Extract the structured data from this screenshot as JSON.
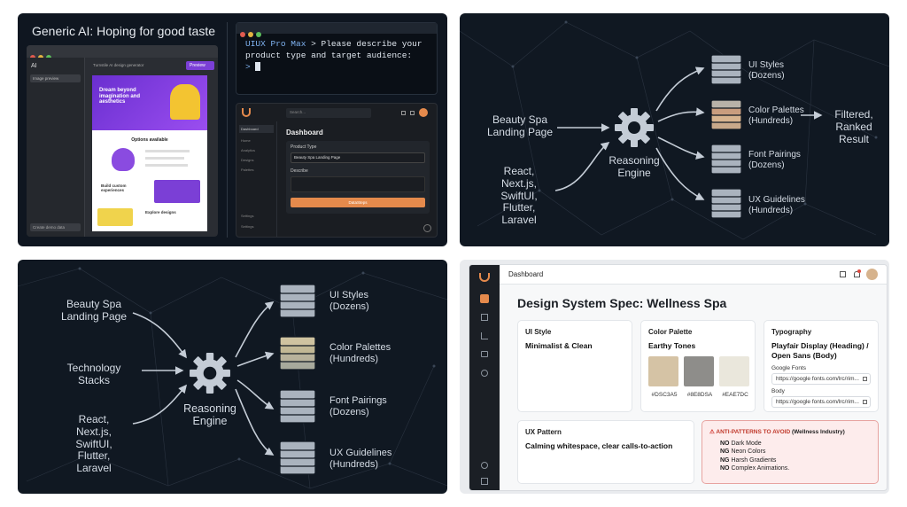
{
  "p1": {
    "title": "Generic AI: Hoping for good taste",
    "mock": {
      "sidebar_title": "AI",
      "sidebar_item": "Image preview",
      "sidebar_footer": "Create demo data",
      "top_input": "Turnstile AI design generator",
      "top_button": "Preview",
      "hero_text": "Dream beyond imagination and aesthetics",
      "section_title": "Options available",
      "section2_title": "Build custom experiences",
      "footer_title": "Explore designs"
    },
    "terminal": {
      "line1_prefix": "UIUX Pro Max",
      "line1_rest": " > Please describe your",
      "line2": "product type and target audience:",
      "prompt": ">"
    },
    "dash": {
      "search": "Search...",
      "nav": [
        "Dashboard",
        "Home",
        "Analytics",
        "Designs",
        "Palettes",
        "Settings",
        "Settings"
      ],
      "title": "Dashboard",
      "field1_label": "Product Type",
      "field1_value": "Beauty Spa Landing Page",
      "field2_label": "Describe",
      "button": "DataSteps"
    }
  },
  "p2": {
    "input1": "Beauty Spa\nLanding Page",
    "input2": "React,\nNext.js,\nSwiftUI,\nFlutter,\nLaravel",
    "engine": "Reasoning\nEngine",
    "stacks": [
      "UI Styles\n(Dozens)",
      "Color Palettes\n(Hundreds)",
      "Font Pairings\n(Dozens)",
      "UX Guidelines\n(Hundreds)"
    ],
    "result": "Filtered,\nRanked\nResult"
  },
  "p3": {
    "input1": "Beauty Spa\nLanding Page",
    "input2": "Technology\nStacks",
    "input3": "React,\nNext.js,\nSwiftUI,\nFlutter,\nLaravel",
    "engine": "Reasoning\nEngine",
    "stacks": [
      "UI Styles\n(Dozens)",
      "Color Palettes\n(Hundreds)",
      "Font Pairings\n(Dozens)",
      "UX Guidelines\n(Hundreds)"
    ]
  },
  "p4": {
    "header": "Dashboard",
    "title": "Design System Spec: Wellness Spa",
    "ui_style": {
      "label": "UI Style",
      "value": "Minimalist & Clean"
    },
    "palette": {
      "label": "Color Palette",
      "value": "Earthy Tones",
      "swatches": [
        {
          "hex": "#D5C3A5",
          "label": "#DSC3A5"
        },
        {
          "hex": "#8E8D8A",
          "label": "#8E8DSA"
        },
        {
          "hex": "#EAE7DC",
          "label": "#EAE7DC"
        }
      ]
    },
    "typography": {
      "label": "Typography",
      "value": "Playfair Display (Heading) / Open Sans (Body)",
      "gf_label": "Google Fonts",
      "gf_url": "https://google fonts.com/lrc/rim...",
      "body_label": "Body",
      "body_url": "https://google fonts.com/lrc/rim..."
    },
    "ux": {
      "label": "UX Pattern",
      "value": "Calming whitespace, clear calls-to-action"
    },
    "anti": {
      "title": "ANTI-PATTERNS TO AVOID",
      "title_suffix": "(Wellness Industry)",
      "items": [
        {
          "prefix": "NO",
          "text": "Dark Mode"
        },
        {
          "prefix": "NG",
          "text": "Neon Colors"
        },
        {
          "prefix": "NG",
          "text": "Harsh Gradients"
        },
        {
          "prefix": "NO",
          "text": "Complex Animations."
        }
      ]
    }
  },
  "colors": {
    "accent": "#E58A4C",
    "purple": "#7B3FD6",
    "panel": "#101822",
    "terminal_text": "#7FB2F0"
  }
}
